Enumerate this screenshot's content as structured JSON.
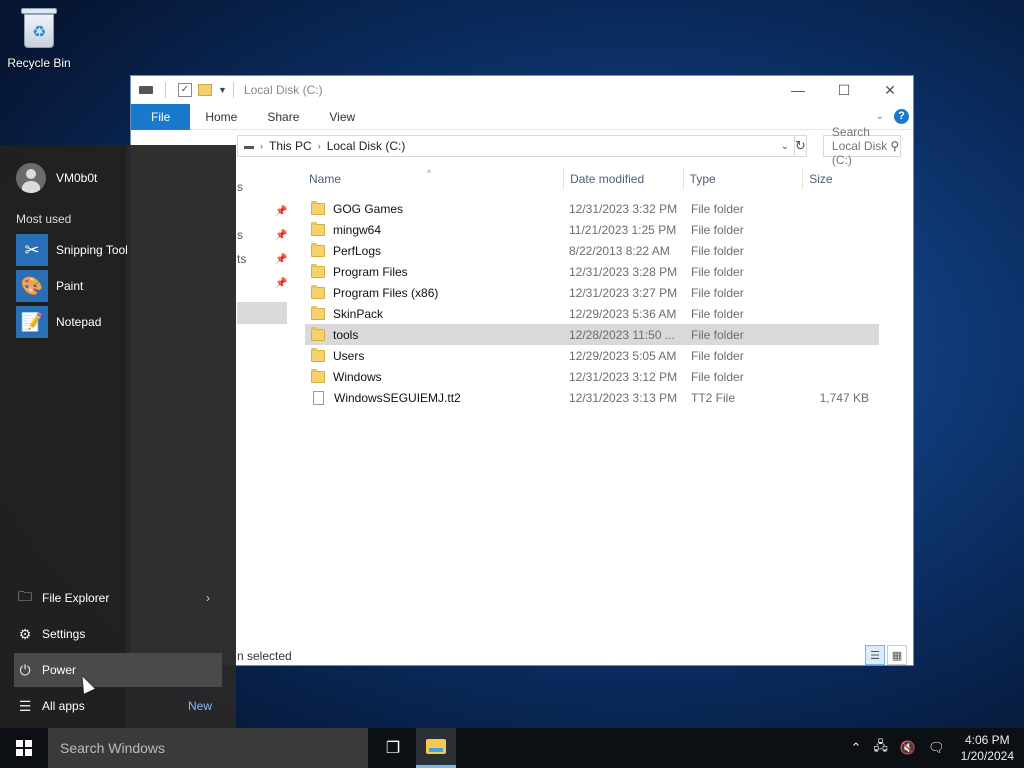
{
  "desktop": {
    "recycle_bin_label": "Recycle Bin"
  },
  "explorer": {
    "title": "Local Disk (C:)",
    "ribbon_tabs": [
      "File",
      "Home",
      "Share",
      "View"
    ],
    "breadcrumb": [
      "This PC",
      "Local Disk (C:)"
    ],
    "search_placeholder": "Search Local Disk (C:)",
    "columns": {
      "name": "Name",
      "date": "Date modified",
      "type": "Type",
      "size": "Size"
    },
    "nav_fragments": [
      "s",
      "s",
      "ts"
    ],
    "files": [
      {
        "name": "GOG Games",
        "date": "12/31/2023 3:32 PM",
        "type": "File folder",
        "size": "",
        "kind": "folder"
      },
      {
        "name": "mingw64",
        "date": "11/21/2023 1:25 PM",
        "type": "File folder",
        "size": "",
        "kind": "folder"
      },
      {
        "name": "PerfLogs",
        "date": "8/22/2013 8:22 AM",
        "type": "File folder",
        "size": "",
        "kind": "folder"
      },
      {
        "name": "Program Files",
        "date": "12/31/2023 3:28 PM",
        "type": "File folder",
        "size": "",
        "kind": "folder"
      },
      {
        "name": "Program Files (x86)",
        "date": "12/31/2023 3:27 PM",
        "type": "File folder",
        "size": "",
        "kind": "folder"
      },
      {
        "name": "SkinPack",
        "date": "12/29/2023 5:36 AM",
        "type": "File folder",
        "size": "",
        "kind": "folder"
      },
      {
        "name": "tools",
        "date": "12/28/2023 11:50 ...",
        "type": "File folder",
        "size": "",
        "kind": "folder",
        "selected": true
      },
      {
        "name": "Users",
        "date": "12/29/2023 5:05 AM",
        "type": "File folder",
        "size": "",
        "kind": "folder"
      },
      {
        "name": "Windows",
        "date": "12/31/2023 3:12 PM",
        "type": "File folder",
        "size": "",
        "kind": "folder"
      },
      {
        "name": "WindowsSEGUIEMJ.tt2",
        "date": "12/31/2023 3:13 PM",
        "type": "TT2 File",
        "size": "1,747 KB",
        "kind": "file"
      }
    ],
    "status_text": "n selected"
  },
  "start_menu": {
    "user_name": "VM0b0t",
    "most_used_label": "Most used",
    "apps": [
      "Snipping Tool",
      "Paint",
      "Notepad"
    ],
    "file_explorer": "File Explorer",
    "settings": "Settings",
    "power": "Power",
    "all_apps": "All apps",
    "new_badge": "New"
  },
  "taskbar": {
    "search_placeholder": "Search Windows",
    "time": "4:06 PM",
    "date": "1/20/2024"
  }
}
